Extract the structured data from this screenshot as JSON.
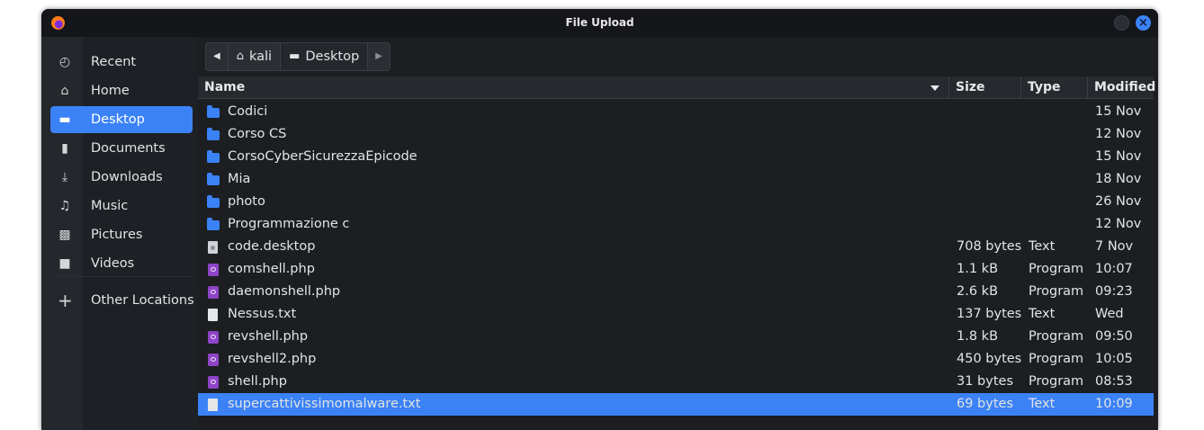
{
  "window": {
    "title": "File Upload"
  },
  "sidebar": {
    "items": [
      {
        "label": "Recent",
        "icon": "clock-icon",
        "glyph": "◴"
      },
      {
        "label": "Home",
        "icon": "home-icon",
        "glyph": "⌂"
      },
      {
        "label": "Desktop",
        "icon": "desktop-icon",
        "glyph": "▬",
        "active": true
      },
      {
        "label": "Documents",
        "icon": "document-icon",
        "glyph": "▮"
      },
      {
        "label": "Downloads",
        "icon": "download-icon",
        "glyph": "⤓"
      },
      {
        "label": "Music",
        "icon": "music-icon",
        "glyph": "♫"
      },
      {
        "label": "Pictures",
        "icon": "picture-icon",
        "glyph": "▩"
      },
      {
        "label": "Videos",
        "icon": "video-icon",
        "glyph": "■"
      }
    ],
    "other_locations": {
      "label": "Other Locations",
      "icon": "plus-icon",
      "glyph": "+"
    }
  },
  "pathbar": {
    "back_icon": "chevron-left-icon",
    "segments": [
      {
        "label": "kali",
        "icon": "home-icon"
      },
      {
        "label": "Desktop",
        "icon": "desktop-icon",
        "current": true
      }
    ],
    "forward_icon": "chevron-right-icon"
  },
  "columns": {
    "name": "Name",
    "size": "Size",
    "type": "Type",
    "modified": "Modified"
  },
  "files": [
    {
      "name": "Codici",
      "kind": "folder",
      "size": "",
      "type": "",
      "modified": "15 Nov"
    },
    {
      "name": "Corso CS",
      "kind": "folder",
      "size": "",
      "type": "",
      "modified": "12 Nov"
    },
    {
      "name": "CorsoCyberSicurezzaEpicode",
      "kind": "folder",
      "size": "",
      "type": "",
      "modified": "15 Nov"
    },
    {
      "name": "Mia",
      "kind": "folder",
      "size": "",
      "type": "",
      "modified": "18 Nov"
    },
    {
      "name": "photo",
      "kind": "folder",
      "size": "",
      "type": "",
      "modified": "26 Nov"
    },
    {
      "name": "Programmazione c",
      "kind": "folder",
      "size": "",
      "type": "",
      "modified": "12 Nov"
    },
    {
      "name": "code.desktop",
      "kind": "desktop",
      "size": "708 bytes",
      "type": "Text",
      "modified": "7 Nov"
    },
    {
      "name": "comshell.php",
      "kind": "php",
      "size": "1.1 kB",
      "type": "Program",
      "modified": "10:07"
    },
    {
      "name": "daemonshell.php",
      "kind": "php",
      "size": "2.6 kB",
      "type": "Program",
      "modified": "09:23"
    },
    {
      "name": "Nessus.txt",
      "kind": "text",
      "size": "137 bytes",
      "type": "Text",
      "modified": "Wed"
    },
    {
      "name": "revshell.php",
      "kind": "php",
      "size": "1.8 kB",
      "type": "Program",
      "modified": "09:50"
    },
    {
      "name": "revshell2.php",
      "kind": "php",
      "size": "450 bytes",
      "type": "Program",
      "modified": "10:05"
    },
    {
      "name": "shell.php",
      "kind": "php",
      "size": "31 bytes",
      "type": "Program",
      "modified": "08:53"
    },
    {
      "name": "supercattivissimomalware.txt",
      "kind": "text",
      "size": "69 bytes",
      "type": "Text",
      "modified": "10:09",
      "selected": true
    }
  ],
  "colors": {
    "accent": "#3b82f6",
    "folder": "#3b82f6",
    "php": "#8e44c7",
    "background": "#1c1e22"
  }
}
